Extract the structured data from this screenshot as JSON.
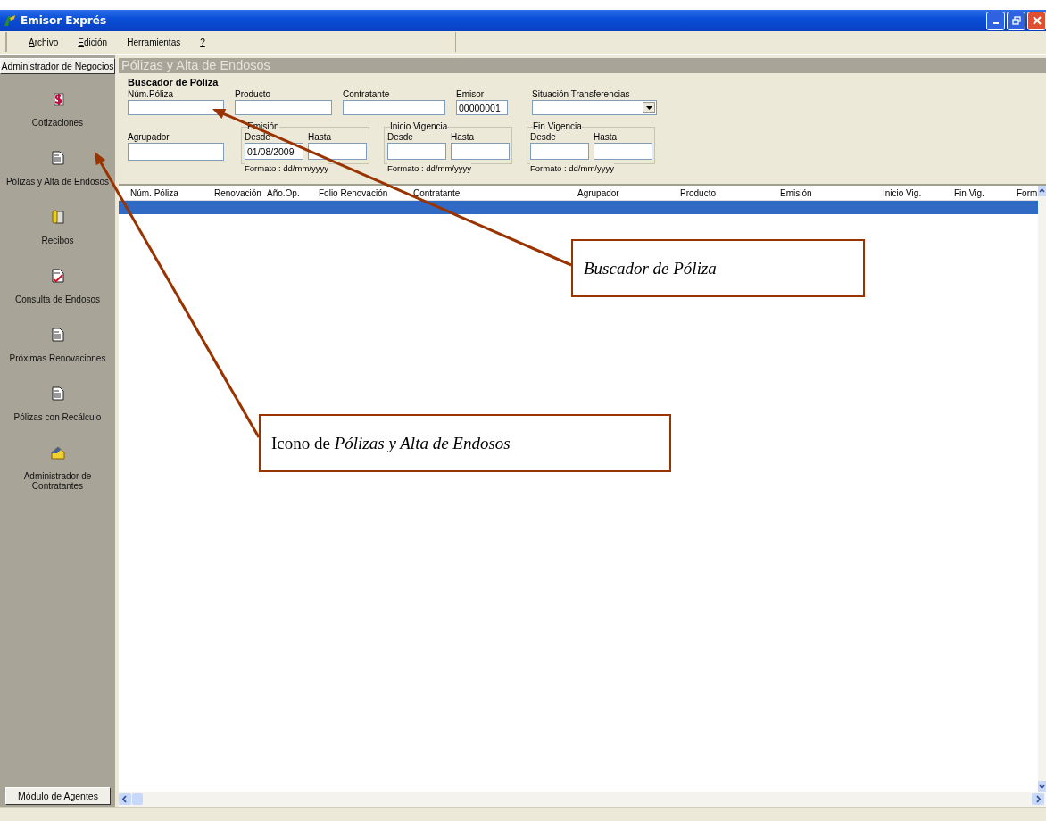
{
  "window": {
    "title": "Emisor Exprés"
  },
  "menu": [
    {
      "label": "Archivo",
      "underlined": true
    },
    {
      "label": "Edición",
      "underlined": true
    },
    {
      "label": "Herramientas",
      "underlined": false
    },
    {
      "label": "?",
      "underlined": true
    }
  ],
  "sidebar": {
    "header": "Administrador de Negocios",
    "footer": "Módulo de Agentes",
    "items": [
      {
        "label": "Cotizaciones",
        "kind": "money"
      },
      {
        "label": "Pólizas y Alta de Endosos",
        "kind": "document"
      },
      {
        "label": "Recibos",
        "kind": "clip"
      },
      {
        "label": "Consulta de Endosos",
        "kind": "check"
      },
      {
        "label": "Próximas Renovaciones",
        "kind": "document"
      },
      {
        "label": "Pólizas con Recálculo",
        "kind": "document"
      },
      {
        "label": "Administrador de Contratantes",
        "kind": "house"
      }
    ]
  },
  "panel": {
    "title": "Pólizas y Alta de Endosos",
    "search_title": "Buscador de Póliza",
    "fields": [
      {
        "label": "Núm.Póliza",
        "kind": "text"
      },
      {
        "label": "Producto",
        "kind": "text"
      },
      {
        "label": "Contratante",
        "kind": "text"
      },
      {
        "label": "Emisor",
        "kind": "text",
        "value": "00000001"
      },
      {
        "label": "Situación Transferencias",
        "kind": "select"
      }
    ],
    "grouper": {
      "label": "Agrupador"
    },
    "date_groups": [
      {
        "title": "Emisión",
        "from_label": "Desde",
        "to_label": "Hasta",
        "from_value": "01/08/2009",
        "format": "Formato : dd/mm/yyyy"
      },
      {
        "title": "Inicio Vigencia",
        "from_label": "Desde",
        "to_label": "Hasta",
        "format": "Formato : dd/mm/yyyy"
      },
      {
        "title": "Fin Vigencia",
        "from_label": "Desde",
        "to_label": "Hasta",
        "format": "Formato : dd/mm/yyyy"
      }
    ]
  },
  "table": {
    "columns": [
      "Núm. Póliza",
      "Renovación",
      "Año.Op.",
      "Folio Renovación",
      "Contratante",
      "Agrupador",
      "Producto",
      "Emisión",
      "Inicio Vig.",
      "Fin Vig.",
      "Form"
    ],
    "rows": [
      {
        "selected": true
      }
    ]
  },
  "annotations": [
    {
      "kind": "search",
      "text": "*Buscador de Póliza*"
    },
    {
      "kind": "icon",
      "text": "Icono de *Pólizas y Alta de Endosos*"
    }
  ]
}
